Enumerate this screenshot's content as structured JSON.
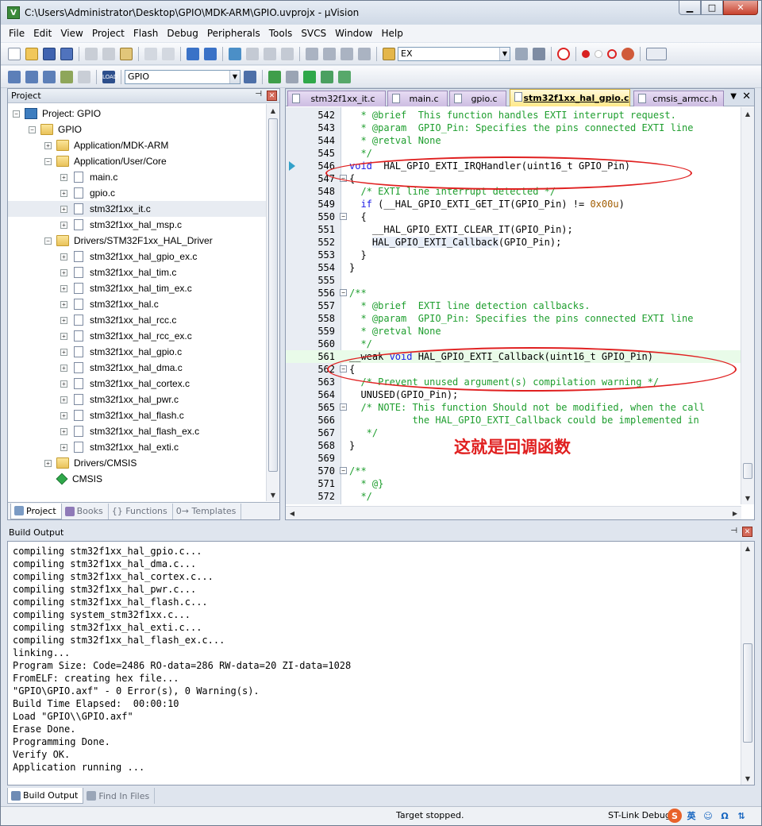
{
  "window": {
    "title": "C:\\Users\\Administrator\\Desktop\\GPIO\\MDK-ARM\\GPIO.uvprojx - µVision",
    "minimize": "▁",
    "maximize": "□",
    "close": "✕"
  },
  "menu": [
    "File",
    "Edit",
    "View",
    "Project",
    "Flash",
    "Debug",
    "Peripherals",
    "Tools",
    "SVCS",
    "Window",
    "Help"
  ],
  "toolbar": {
    "find_value": "EX",
    "target_value": "GPIO"
  },
  "project_pane": {
    "title": "Project",
    "pin": "⊣",
    "close": "✕",
    "tree": [
      {
        "label": "Project: GPIO",
        "level": 0,
        "expander": "−",
        "icon": "project-icon"
      },
      {
        "label": "GPIO",
        "level": 1,
        "expander": "−",
        "icon": "folder-icon"
      },
      {
        "label": "Application/MDK-ARM",
        "level": 2,
        "expander": "+",
        "icon": "folder-icon"
      },
      {
        "label": "Application/User/Core",
        "level": 2,
        "expander": "−",
        "icon": "folder-icon"
      },
      {
        "label": "main.c",
        "level": 3,
        "expander": "+",
        "icon": "file-icon"
      },
      {
        "label": "gpio.c",
        "level": 3,
        "expander": "+",
        "icon": "file-icon"
      },
      {
        "label": "stm32f1xx_it.c",
        "level": 3,
        "expander": "+",
        "icon": "file-icon",
        "selected": true
      },
      {
        "label": "stm32f1xx_hal_msp.c",
        "level": 3,
        "expander": "+",
        "icon": "file-icon"
      },
      {
        "label": "Drivers/STM32F1xx_HAL_Driver",
        "level": 2,
        "expander": "−",
        "icon": "folder-icon"
      },
      {
        "label": "stm32f1xx_hal_gpio_ex.c",
        "level": 3,
        "expander": "+",
        "icon": "file-icon"
      },
      {
        "label": "stm32f1xx_hal_tim.c",
        "level": 3,
        "expander": "+",
        "icon": "file-icon"
      },
      {
        "label": "stm32f1xx_hal_tim_ex.c",
        "level": 3,
        "expander": "+",
        "icon": "file-icon"
      },
      {
        "label": "stm32f1xx_hal.c",
        "level": 3,
        "expander": "+",
        "icon": "file-icon"
      },
      {
        "label": "stm32f1xx_hal_rcc.c",
        "level": 3,
        "expander": "+",
        "icon": "file-icon"
      },
      {
        "label": "stm32f1xx_hal_rcc_ex.c",
        "level": 3,
        "expander": "+",
        "icon": "file-icon"
      },
      {
        "label": "stm32f1xx_hal_gpio.c",
        "level": 3,
        "expander": "+",
        "icon": "file-icon"
      },
      {
        "label": "stm32f1xx_hal_dma.c",
        "level": 3,
        "expander": "+",
        "icon": "file-icon"
      },
      {
        "label": "stm32f1xx_hal_cortex.c",
        "level": 3,
        "expander": "+",
        "icon": "file-icon"
      },
      {
        "label": "stm32f1xx_hal_pwr.c",
        "level": 3,
        "expander": "+",
        "icon": "file-icon"
      },
      {
        "label": "stm32f1xx_hal_flash.c",
        "level": 3,
        "expander": "+",
        "icon": "file-icon"
      },
      {
        "label": "stm32f1xx_hal_flash_ex.c",
        "level": 3,
        "expander": "+",
        "icon": "file-icon"
      },
      {
        "label": "stm32f1xx_hal_exti.c",
        "level": 3,
        "expander": "+",
        "icon": "file-icon"
      },
      {
        "label": "Drivers/CMSIS",
        "level": 2,
        "expander": "+",
        "icon": "folder-icon"
      },
      {
        "label": "CMSIS",
        "level": 2,
        "expander": "",
        "icon": "cmsis-icon"
      }
    ],
    "tabs": [
      {
        "label": "Project",
        "active": true
      },
      {
        "label": "Books",
        "active": false
      },
      {
        "label": "{} Functions",
        "active": false
      },
      {
        "label": "0→ Templates",
        "active": false
      }
    ]
  },
  "editor": {
    "tabs": [
      {
        "label": "stm32f1xx_it.c",
        "active": false
      },
      {
        "label": "main.c",
        "active": false
      },
      {
        "label": "gpio.c",
        "active": false
      },
      {
        "label": "stm32f1xx_hal_gpio.c",
        "active": true
      },
      {
        "label": "cmsis_armcc.h",
        "active": false
      }
    ],
    "dropdown": "▼",
    "close": "✕",
    "lines": [
      {
        "n": "542",
        "fold": "",
        "segs": [
          [
            "cm",
            "  * @brief  This function handles EXTI interrupt request."
          ]
        ]
      },
      {
        "n": "543",
        "fold": "",
        "segs": [
          [
            "cm",
            "  * @param  GPIO_Pin: Specifies the pins connected EXTI line"
          ]
        ]
      },
      {
        "n": "544",
        "fold": "",
        "segs": [
          [
            "cm",
            "  * @retval None"
          ]
        ]
      },
      {
        "n": "545",
        "fold": "",
        "segs": [
          [
            "cm",
            "  */"
          ]
        ]
      },
      {
        "n": "546",
        "fold": "",
        "segs": [
          [
            "kw",
            "void"
          ],
          [
            "",
            "  HAL_GPIO_EXTI_IRQHandler(uint16_t GPIO_Pin)"
          ]
        ],
        "arrow": true
      },
      {
        "n": "547",
        "fold": "−",
        "segs": [
          [
            "",
            "{"
          ]
        ]
      },
      {
        "n": "548",
        "fold": "",
        "segs": [
          [
            "cm",
            "  /* EXTI line interrupt detected */"
          ]
        ]
      },
      {
        "n": "549",
        "fold": "",
        "segs": [
          [
            "",
            "  "
          ],
          [
            "kw",
            "if"
          ],
          [
            "",
            " (__HAL_GPIO_EXTI_GET_IT(GPIO_Pin) != "
          ],
          [
            "num",
            "0x00u"
          ],
          [
            "",
            ")"
          ]
        ]
      },
      {
        "n": "550",
        "fold": "−",
        "segs": [
          [
            "",
            "  {"
          ]
        ]
      },
      {
        "n": "551",
        "fold": "",
        "segs": [
          [
            "",
            "    __HAL_GPIO_EXTI_CLEAR_IT(GPIO_Pin);"
          ]
        ]
      },
      {
        "n": "552",
        "fold": "",
        "segs": [
          [
            "",
            "    "
          ],
          [
            "hl",
            "HAL_GPIO_EXTI_Callback"
          ],
          [
            "",
            "(GPIO_Pin);"
          ]
        ]
      },
      {
        "n": "553",
        "fold": "",
        "segs": [
          [
            "",
            "  }"
          ]
        ]
      },
      {
        "n": "554",
        "fold": "",
        "segs": [
          [
            "",
            "}"
          ]
        ]
      },
      {
        "n": "555",
        "fold": "",
        "segs": [
          [
            "",
            ""
          ]
        ]
      },
      {
        "n": "556",
        "fold": "−",
        "segs": [
          [
            "cm",
            "/**"
          ]
        ]
      },
      {
        "n": "557",
        "fold": "",
        "segs": [
          [
            "cm",
            "  * @brief  EXTI line detection callbacks."
          ]
        ]
      },
      {
        "n": "558",
        "fold": "",
        "segs": [
          [
            "cm",
            "  * @param  GPIO_Pin: Specifies the pins connected EXTI line"
          ]
        ]
      },
      {
        "n": "559",
        "fold": "",
        "segs": [
          [
            "cm",
            "  * @retval None"
          ]
        ]
      },
      {
        "n": "560",
        "fold": "",
        "segs": [
          [
            "cm",
            "  */"
          ]
        ]
      },
      {
        "n": "561",
        "fold": "",
        "segs": [
          [
            "",
            "__weak "
          ],
          [
            "kw",
            "void"
          ],
          [
            "",
            " HAL_GPIO_EXTI_Callback(uint16_t GPIO_Pin)"
          ]
        ],
        "current": true
      },
      {
        "n": "562",
        "fold": "−",
        "segs": [
          [
            "",
            "{"
          ]
        ]
      },
      {
        "n": "563",
        "fold": "",
        "segs": [
          [
            "cm",
            "  /* Prevent unused argument(s) compilation warning */"
          ]
        ]
      },
      {
        "n": "564",
        "fold": "",
        "segs": [
          [
            "",
            "  UNUSED(GPIO_Pin);"
          ]
        ]
      },
      {
        "n": "565",
        "fold": "−",
        "segs": [
          [
            "cm",
            "  /* NOTE: This function Should not be modified, when the call"
          ]
        ]
      },
      {
        "n": "566",
        "fold": "",
        "segs": [
          [
            "cm",
            "           the HAL_GPIO_EXTI_Callback could be implemented in"
          ]
        ]
      },
      {
        "n": "567",
        "fold": "",
        "segs": [
          [
            "cm",
            "   */"
          ]
        ]
      },
      {
        "n": "568",
        "fold": "",
        "segs": [
          [
            "",
            "}"
          ]
        ]
      },
      {
        "n": "569",
        "fold": "",
        "segs": [
          [
            "",
            ""
          ]
        ]
      },
      {
        "n": "570",
        "fold": "−",
        "segs": [
          [
            "cm",
            "/**"
          ]
        ]
      },
      {
        "n": "571",
        "fold": "",
        "segs": [
          [
            "cm",
            "  * @}"
          ]
        ]
      },
      {
        "n": "572",
        "fold": "",
        "segs": [
          [
            "cm",
            "  */"
          ]
        ]
      }
    ],
    "annotation": "这就是回调函数"
  },
  "build": {
    "title": "Build Output",
    "pin": "⊣",
    "close": "✕",
    "lines": [
      "compiling stm32f1xx_hal_gpio.c...",
      "compiling stm32f1xx_hal_dma.c...",
      "compiling stm32f1xx_hal_cortex.c...",
      "compiling stm32f1xx_hal_pwr.c...",
      "compiling stm32f1xx_hal_flash.c...",
      "compiling system_stm32f1xx.c...",
      "compiling stm32f1xx_hal_exti.c...",
      "compiling stm32f1xx_hal_flash_ex.c...",
      "linking...",
      "Program Size: Code=2486 RO-data=286 RW-data=20 ZI-data=1028",
      "FromELF: creating hex file...",
      "\"GPIO\\GPIO.axf\" - 0 Error(s), 0 Warning(s).",
      "Build Time Elapsed:  00:00:10",
      "Load \"GPIO\\\\GPIO.axf\"",
      "Erase Done.",
      "Programming Done.",
      "Verify OK.",
      "Application running ..."
    ],
    "tabs": [
      {
        "label": "Build Output",
        "active": true
      },
      {
        "label": "Find In Files",
        "active": false
      }
    ]
  },
  "status": {
    "text": "Target stopped.",
    "debugger": "ST-Link Debugg",
    "ime": [
      "S",
      "英",
      "☺",
      "Ω",
      "⇅"
    ]
  },
  "colors": {
    "comment": "#1e9e2e",
    "keyword": "#1a1ae6",
    "number": "#a15c00",
    "annotation": "#e02020"
  }
}
